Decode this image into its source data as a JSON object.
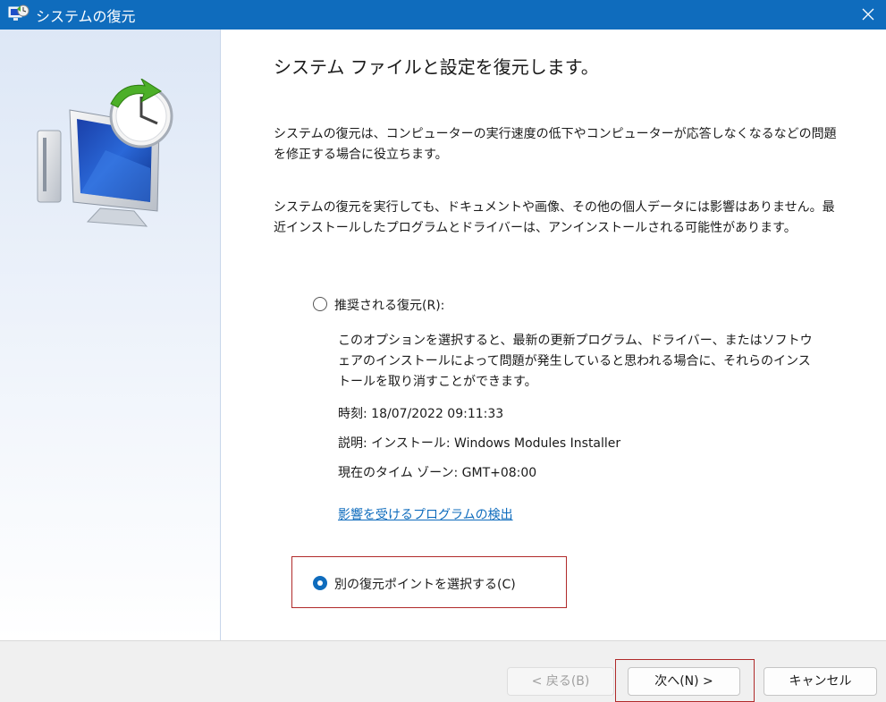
{
  "window": {
    "title": "システムの復元",
    "close_symbol": "✕",
    "icon": "system-restore-icon"
  },
  "main": {
    "heading": "システム ファイルと設定を復元します。",
    "paragraph1": "システムの復元は、コンピューターの実行速度の低下やコンピューターが応答しなくなるなどの問題を修正する場合に役立ちます。",
    "paragraph2": "システムの復元を実行しても、ドキュメントや画像、その他の個人データには影響はありません。最近インストールしたプログラムとドライバーは、アンインストールされる可能性があります。"
  },
  "recommended": {
    "label": "推奨される復元(R):",
    "selected": false,
    "description": "このオプションを選択すると、最新の更新プログラム、ドライバー、またはソフトウェアのインストールによって問題が発生していると思われる場合に、それらのインストールを取り消すことができます。",
    "time": "時刻: 18/07/2022 09:11:33",
    "description_line": "説明: インストール: Windows Modules Installer",
    "timezone": "現在のタイム ゾーン: GMT+08:00",
    "link": "影響を受けるプログラムの検出"
  },
  "other": {
    "label": "別の復元ポイントを選択する(C)",
    "selected": true
  },
  "buttons": {
    "back": "< 戻る(B)",
    "next": "次へ(N) >",
    "cancel": "キャンセル"
  },
  "colors": {
    "accent": "#0f6cbd",
    "highlight": "#b02a2a",
    "link": "#0f6cbd"
  }
}
